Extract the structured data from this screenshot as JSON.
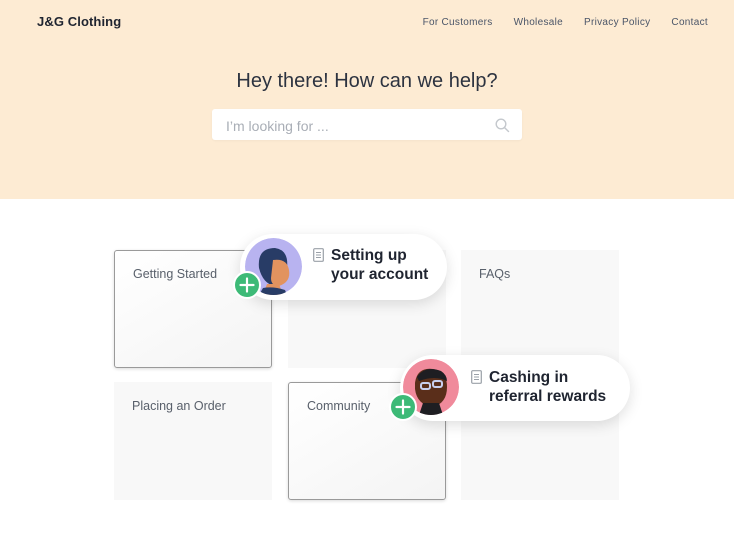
{
  "brand": "J&G Clothing",
  "nav": [
    "For Customers",
    "Wholesale",
    "Privacy Policy",
    "Contact"
  ],
  "headline": "Hey there! How can we help?",
  "search": {
    "placeholder": "I’m looking for ..."
  },
  "cards": {
    "getting_started": "Getting Started",
    "faqs": "FAQs",
    "placing_order": "Placing an Order",
    "community": "Community"
  },
  "bubbles": {
    "setup": {
      "line1": "Setting up",
      "line2": "your account"
    },
    "cashing": {
      "line1": "Cashing in",
      "line2": "referral rewards"
    }
  },
  "colors": {
    "hero_bg": "#fdebd3",
    "plus_green": "#3dba77",
    "avatar1_bg": "#b8b3f0",
    "avatar2_bg": "#f08a9b"
  }
}
